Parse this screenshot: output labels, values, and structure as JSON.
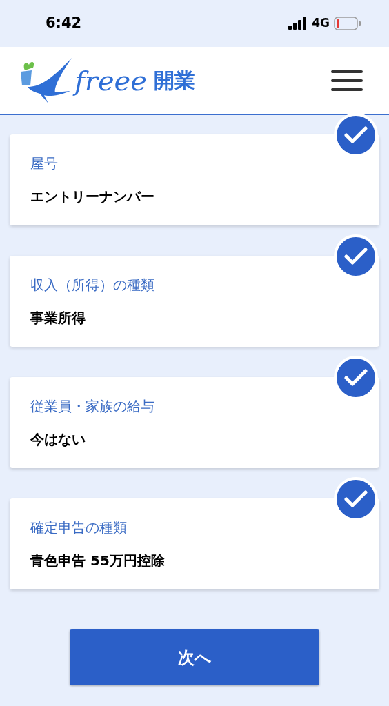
{
  "status_bar": {
    "time": "6:42",
    "network": "4G"
  },
  "header": {
    "brand": "freee",
    "brand_suffix": "開業"
  },
  "cards": [
    {
      "label": "屋号",
      "value": "エントリーナンバー",
      "checked": true
    },
    {
      "label": "収入（所得）の種類",
      "value": "事業所得",
      "checked": true
    },
    {
      "label": "従業員・家族の給与",
      "value": "今はない",
      "checked": true
    },
    {
      "label": "確定申告の種類",
      "value": "青色申告 55万円控除",
      "checked": true
    }
  ],
  "next_button": "次へ"
}
